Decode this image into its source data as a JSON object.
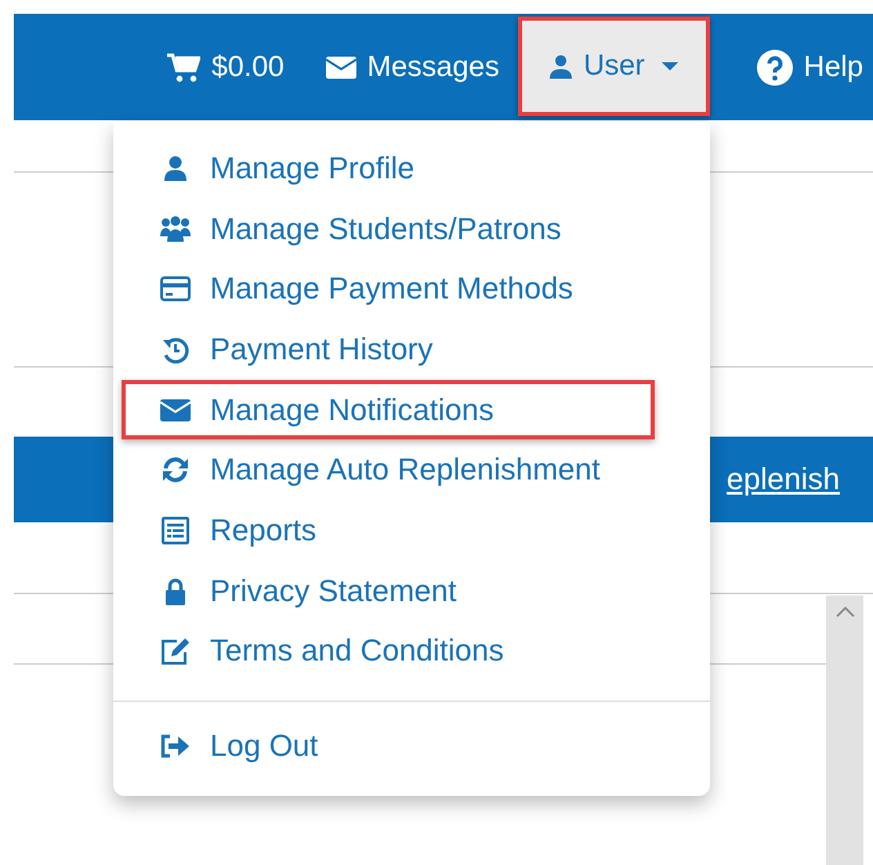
{
  "navbar": {
    "cart": {
      "label": "$0.00"
    },
    "messages": {
      "label": "Messages"
    },
    "user": {
      "label": "User",
      "highlighted": true,
      "expanded": true
    },
    "help": {
      "label": "Help"
    }
  },
  "content": {
    "band_link": "eplenish"
  },
  "user_menu": {
    "items": [
      {
        "label": "Manage Profile",
        "highlighted": false
      },
      {
        "label": "Manage Students/Patrons",
        "highlighted": false
      },
      {
        "label": "Manage Payment Methods",
        "highlighted": false
      },
      {
        "label": "Payment History",
        "highlighted": false
      },
      {
        "label": "Manage Notifications",
        "highlighted": true
      },
      {
        "label": "Manage Auto Replenishment",
        "highlighted": false
      },
      {
        "label": "Reports",
        "highlighted": false
      },
      {
        "label": "Privacy Statement",
        "highlighted": false
      },
      {
        "label": "Terms and Conditions",
        "highlighted": false
      }
    ],
    "footer_items": [
      {
        "label": "Log Out",
        "highlighted": false
      }
    ]
  }
}
